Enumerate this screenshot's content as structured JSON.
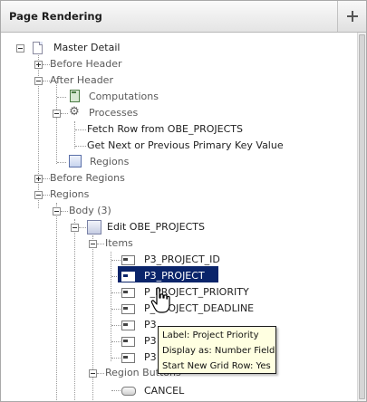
{
  "panel": {
    "title": "Page Rendering"
  },
  "tree": {
    "root": "Master Detail",
    "before_header": "Before Header",
    "after_header": "After Header",
    "computations": "Computations",
    "processes": "Processes",
    "process_1": "Fetch Row from OBE_PROJECTS",
    "process_2": "Get Next or Previous Primary Key Value",
    "regions_sub": "Regions",
    "before_regions": "Before Regions",
    "regions": "Regions",
    "body": "Body (3)",
    "edit_region": "Edit OBE_PROJECTS",
    "items": "Items",
    "item_list": [
      "P3_PROJECT_ID",
      "P3_PROJECT",
      "P3_PROJECT_PRIORITY",
      "P3_PROJECT_DEADLINE",
      "P3_PROJECT_ID_NEXT",
      "P3_PROJECT_ID_PREV",
      "P3_PROJECT_ID_COUNT"
    ],
    "item_list_visible": [
      "P3_PROJECT_ID",
      "P3_PROJECT",
      "P_PROJECT_PRIORITY",
      "P_PROJECT_DEADLINE",
      "P3",
      "P3",
      "P3"
    ],
    "region_buttons": "Region Buttons",
    "cancel": "CANCEL"
  },
  "tooltip": {
    "label": "Label: Project Priority",
    "display_as": "Display as: Number Field",
    "start_new_grid_row": "Start New Grid Row: Yes"
  },
  "colors": {
    "selection": "#0a246a",
    "tooltip_bg": "#ffffe1"
  }
}
